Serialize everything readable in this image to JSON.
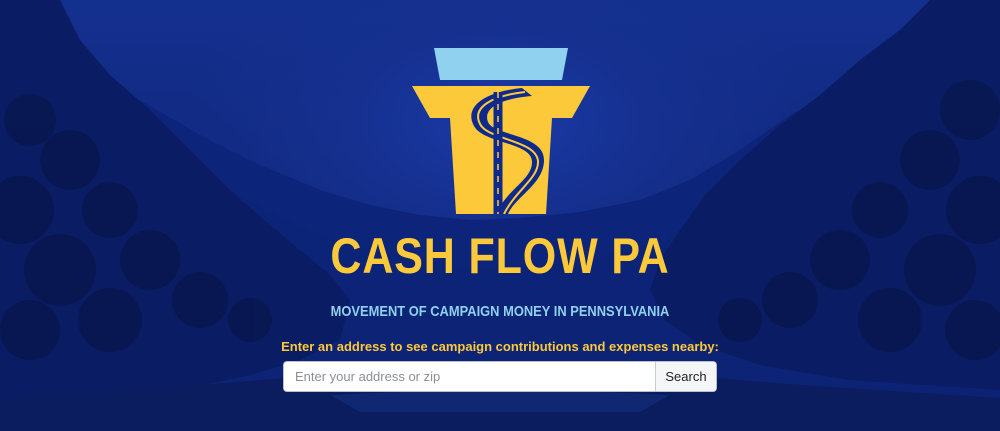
{
  "hero": {
    "title": "CASH FLOW PA",
    "subtitle": "MOVEMENT OF CAMPAIGN MONEY IN PENNSYLVANIA",
    "prompt": "Enter an address to see campaign contributions and expenses nearby:"
  },
  "search": {
    "placeholder": "Enter your address or zip",
    "value": "",
    "button_label": "Search"
  },
  "logo": {
    "icon": "keystone-dollar-road-icon",
    "colors": {
      "keystone": "#fcc93b",
      "cap": "#8fd1ee",
      "road": "#0f2a8a"
    }
  },
  "theme": {
    "background": "#10287d",
    "accent_yellow": "#fcc93b",
    "accent_blue": "#8fd1ee"
  }
}
